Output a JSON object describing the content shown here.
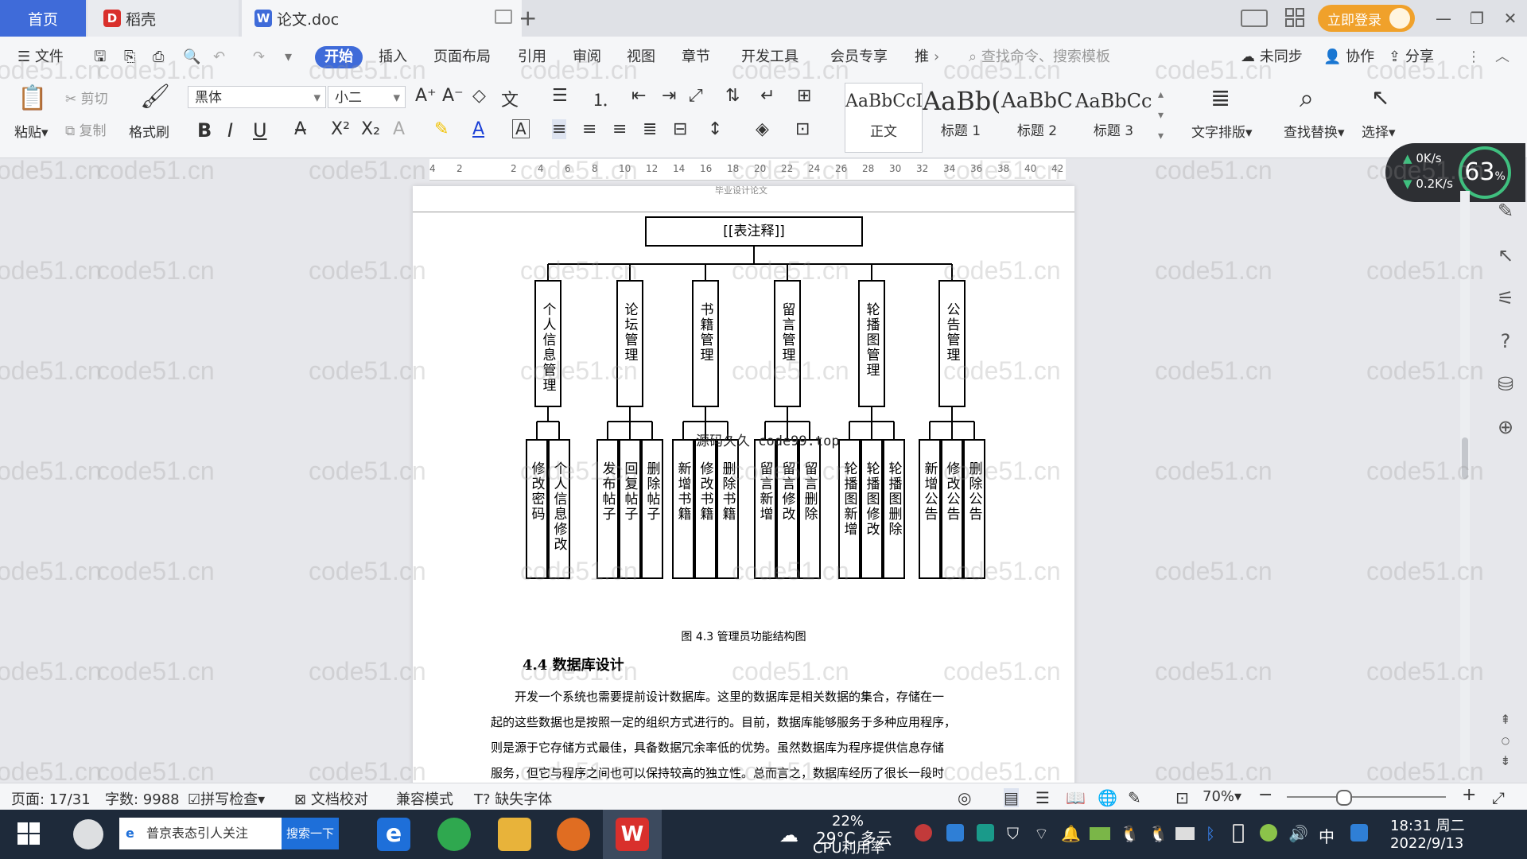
{
  "titlebar": {
    "tabs": [
      {
        "label": "首页"
      },
      {
        "label": "稻壳"
      },
      {
        "label": "论文.doc"
      }
    ],
    "new_tab": "+",
    "login": "立即登录"
  },
  "menubar": {
    "file": "文件",
    "items": [
      "开始",
      "插入",
      "页面布局",
      "引用",
      "审阅",
      "视图",
      "章节",
      "开发工具",
      "会员专享",
      "推"
    ],
    "search_placeholder": "查找命令、搜索模板",
    "sync": "未同步",
    "collab": "协作",
    "share": "分享"
  },
  "ribbon": {
    "paste": "粘贴",
    "cut": "剪切",
    "copy": "复制",
    "format_painter": "格式刷",
    "font": "黑体",
    "size": "小二",
    "styles": [
      {
        "sample": "AaBbCcI",
        "name": "正文"
      },
      {
        "sample": "AaBb(",
        "name": "标题 1"
      },
      {
        "sample": "AaBbC",
        "name": "标题 2"
      },
      {
        "sample": "AaBbCc",
        "name": "标题 3"
      }
    ],
    "text_layout": "文字排版",
    "find_replace": "查找替换",
    "select": "选择"
  },
  "ruler": {
    "ticks": [
      "4",
      "2",
      "",
      "2",
      "4",
      "6",
      "8",
      "10",
      "12",
      "14",
      "16",
      "18",
      "20",
      "22",
      "24",
      "26",
      "28",
      "30",
      "32",
      "34",
      "36",
      "38",
      "40",
      "42"
    ]
  },
  "network": {
    "up": "0K/s",
    "down": "0.2K/s",
    "percent": "63",
    "percent_unit": "%"
  },
  "document": {
    "header_text": "毕业设计论文",
    "chart": {
      "root": "[[表注释]]",
      "modules": [
        {
          "name": "个人信息管理",
          "children": [
            "修改密码",
            "个人信息修改"
          ]
        },
        {
          "name": "论坛管理",
          "children": [
            "发布帖子",
            "回复帖子",
            "删除帖子"
          ]
        },
        {
          "name": "书籍管理",
          "children": [
            "新增书籍",
            "修改书籍",
            "删除书籍"
          ]
        },
        {
          "name": "留言管理",
          "children": [
            "留言新增",
            "留言修改",
            "留言删除"
          ]
        },
        {
          "name": "轮播图管理",
          "children": [
            "轮播图新增",
            "轮播图修改",
            "轮播图删除"
          ]
        },
        {
          "name": "公告管理",
          "children": [
            "新增公告",
            "修改公告",
            "删除公告"
          ]
        }
      ],
      "overlay": "源码久久 code99.top"
    },
    "caption": "图 4.3  管理员功能结构图",
    "heading": "4.4  数据库设计",
    "paragraph": [
      "开发一个系统也需要提前设计数据库。这里的数据库是相关数据的集合，存储在一",
      "起的这些数据也是按照一定的组织方式进行的。目前，数据库能够服务于多种应用程序，",
      "则是源于它存储方式最佳，具备数据冗余率低的优势。虽然数据库为程序提供信息存储",
      "服务，但它与程序之间也可以保持较高的独立性。总而言之，数据库经历了很长一段时"
    ]
  },
  "watermark": "code51.cn",
  "statusbar": {
    "page": "页面: 17/31",
    "words": "字数: 9988",
    "spell": "拼写检查",
    "proof": "文档校对",
    "compat": "兼容模式",
    "missing_font": "缺失字体",
    "zoom": "70%"
  },
  "taskbar": {
    "search_text": "普京表态引人关注",
    "search_button": "搜索一下",
    "weather": "29°C 多云",
    "cpu_percent": "22%",
    "cpu_label": "CPU利用率",
    "ime": "中",
    "time": "18:31 周二",
    "date": "2022/9/13"
  },
  "colors": {
    "accent": "#3f6bd9",
    "login": "#f0a12b",
    "wps_red": "#d9302c"
  }
}
